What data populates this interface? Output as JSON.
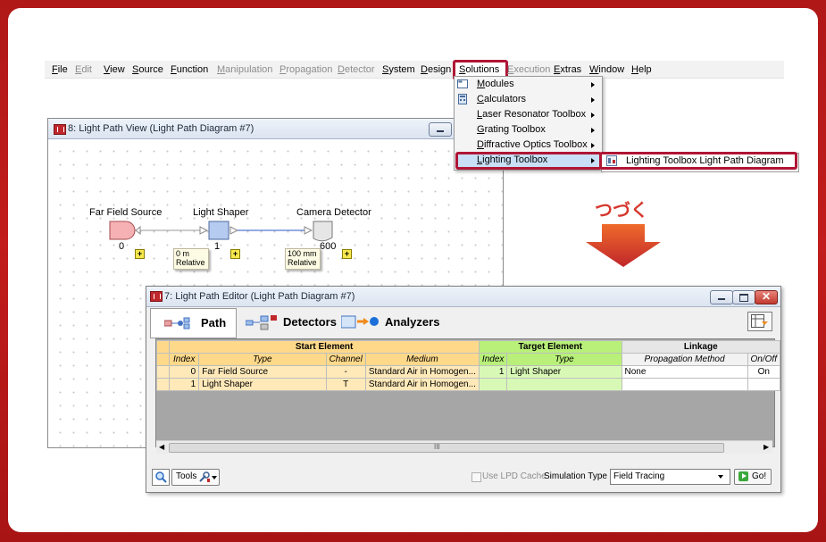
{
  "menubar": {
    "items": [
      {
        "label": "File",
        "enabled": true
      },
      {
        "label": "Edit",
        "enabled": false
      },
      {
        "label": "View",
        "enabled": true
      },
      {
        "label": "Source",
        "enabled": true
      },
      {
        "label": "Function",
        "enabled": true
      },
      {
        "label": "Manipulation",
        "enabled": false
      },
      {
        "label": "Propagation",
        "enabled": false
      },
      {
        "label": "Detector",
        "enabled": false
      },
      {
        "label": "System",
        "enabled": true
      },
      {
        "label": "Design",
        "enabled": true
      },
      {
        "label": "Solutions",
        "enabled": true
      },
      {
        "label": "Execution",
        "enabled": false
      },
      {
        "label": "Extras",
        "enabled": true
      },
      {
        "label": "Window",
        "enabled": true
      },
      {
        "label": "Help",
        "enabled": true
      }
    ]
  },
  "solutions_menu": {
    "items": [
      {
        "label": "Modules",
        "icon": "modules-icon"
      },
      {
        "label": "Calculators",
        "icon": "calculator-icon"
      },
      {
        "label": "Laser Resonator Toolbox",
        "icon": ""
      },
      {
        "label": "Grating Toolbox",
        "icon": ""
      },
      {
        "label": "Diffractive Optics Toolbox",
        "icon": ""
      },
      {
        "label": "Lighting Toolbox",
        "icon": ""
      }
    ],
    "submenu_item": "Lighting Toolbox Light Path Diagram"
  },
  "annotation": {
    "text": "つづく",
    "accent": "#d6372e"
  },
  "path_view": {
    "title": "8: Light Path View (Light Path Diagram #7)",
    "nodes": [
      {
        "label": "Far Field Source",
        "index": "0"
      },
      {
        "label": "Light Shaper",
        "index": "1"
      },
      {
        "label": "Camera Detector",
        "index": "600"
      }
    ],
    "notes": [
      {
        "distance": "0 m",
        "mode": "Relative"
      },
      {
        "distance": "100 mm",
        "mode": "Relative"
      }
    ],
    "plus": "+"
  },
  "editor": {
    "title": "7: Light Path Editor (Light Path Diagram #7)",
    "tabs": [
      {
        "label": "Path",
        "active": true
      },
      {
        "label": "Detectors",
        "active": false
      },
      {
        "label": "Analyzers",
        "active": false
      }
    ],
    "groups": {
      "start": "Start Element",
      "target": "Target Element",
      "linkage": "Linkage"
    },
    "columns": [
      "Index",
      "Type",
      "Channel",
      "Medium",
      "Index",
      "Type",
      "Propagation Method",
      "On/Off"
    ],
    "rows": [
      {
        "index": "0",
        "type": "Far Field Source",
        "channel": "-",
        "medium": "Standard Air in Homogen...",
        "t_index": "1",
        "t_type": "Light Shaper",
        "method": "None",
        "onoff": "On"
      },
      {
        "index": "1",
        "type": "Light Shaper",
        "channel": "T",
        "medium": "Standard Air in Homogen...",
        "t_index": "",
        "t_type": "",
        "method": "",
        "onoff": ""
      }
    ],
    "scroll_grip": "III",
    "footer": {
      "tools_label": "Tools",
      "cache_label": "Use LPD Cache",
      "sim_label": "Simulation Type :",
      "sim_value": "Field Tracing",
      "go_label": "Go!"
    }
  },
  "colors": {
    "start_header": "#ffd98a",
    "start_row": "#ffe9b9",
    "target_header": "#b8f07a",
    "target_row": "#d8f9b6",
    "highlight": "#b01535",
    "frame": "#b81818"
  }
}
